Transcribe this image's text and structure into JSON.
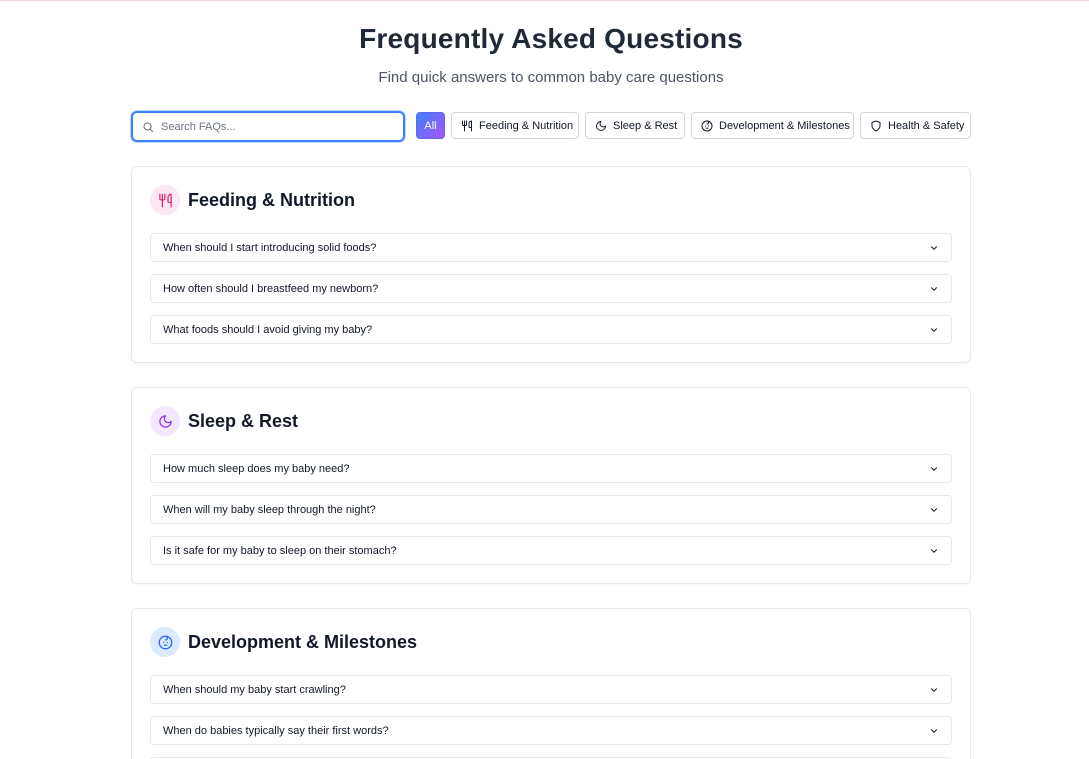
{
  "header": {
    "title": "Frequently Asked Questions",
    "subtitle": "Find quick answers to common baby care questions"
  },
  "search": {
    "placeholder": "Search FAQs...",
    "value": ""
  },
  "filters": [
    {
      "label": "All",
      "icon": "none",
      "active": true
    },
    {
      "label": "Feeding & Nutrition",
      "icon": "utensils-icon",
      "active": false
    },
    {
      "label": "Sleep & Rest",
      "icon": "moon-icon",
      "active": false
    },
    {
      "label": "Development & Milestones",
      "icon": "baby-face-icon",
      "active": false
    },
    {
      "label": "Health & Safety",
      "icon": "shield-icon",
      "active": false
    }
  ],
  "sections": [
    {
      "title": "Feeding & Nutrition",
      "icon": "utensils-icon",
      "icon_color": "#db2777",
      "icon_bg": "#fce7f3",
      "questions": [
        "When should I start introducing solid foods?",
        "How often should I breastfeed my newborn?",
        "What foods should I avoid giving my baby?"
      ]
    },
    {
      "title": "Sleep & Rest",
      "icon": "moon-icon",
      "icon_color": "#9333ea",
      "icon_bg": "#f3e8ff",
      "questions": [
        "How much sleep does my baby need?",
        "When will my baby sleep through the night?",
        "Is it safe for my baby to sleep on their stomach?"
      ]
    },
    {
      "title": "Development & Milestones",
      "icon": "baby-face-icon",
      "icon_color": "#2563eb",
      "icon_bg": "#dbeafe",
      "questions": [
        "When should my baby start crawling?",
        "When do babies typically say their first words?"
      ]
    }
  ],
  "colors": {
    "accent_from": "#3b82f6",
    "accent_to": "#a855f7",
    "border": "#e5e7eb",
    "title": "#1f2937"
  }
}
